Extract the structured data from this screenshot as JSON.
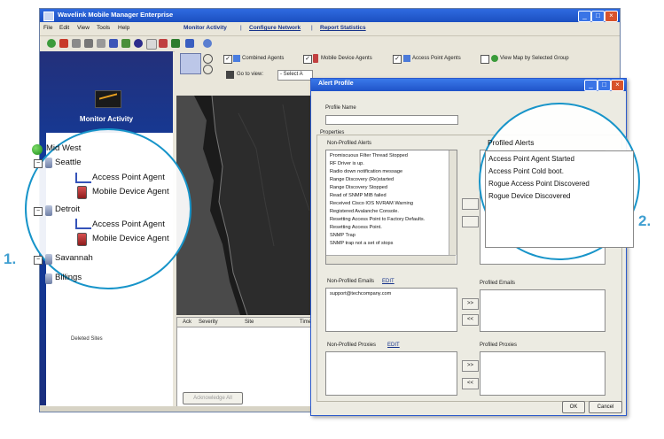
{
  "app": {
    "title": "Wavelink Mobile Manager Enterprise",
    "menu": [
      "File",
      "Edit",
      "View",
      "Tools",
      "Help"
    ],
    "nav": [
      "Monitor Activity",
      "Configure Network",
      "Report Statistics"
    ],
    "separator": "|"
  },
  "left_pane": {
    "title": "Monitor Activity",
    "deleted_sites": "Deleted Sites"
  },
  "map_toolbar": {
    "combined_agents": "Combined Agents",
    "mobile_device_agents": "Mobile Device Agents",
    "access_point_agents": "Access Point Agents",
    "view_map": "View Map by Selected Group",
    "go_to_view": "Go to view:",
    "select_value": "- Select A"
  },
  "grid": {
    "columns": [
      "Ack",
      "Severity",
      "Site",
      "Time"
    ],
    "acknowledge_button": "Acknowledge All"
  },
  "tree": {
    "root": "Mid West",
    "items": [
      {
        "label": "Seattle",
        "level": 1
      },
      {
        "label": "Access Point Agent",
        "level": 2
      },
      {
        "label": "Mobile Device Agent",
        "level": 2
      },
      {
        "label": "Detroit",
        "level": 1
      },
      {
        "label": "Access Point Agent",
        "level": 2
      },
      {
        "label": "Mobile Device Agent",
        "level": 2
      },
      {
        "label": "Savannah",
        "level": 1
      },
      {
        "label": "Billings",
        "level": 1
      }
    ]
  },
  "dialog": {
    "title": "Alert Profile",
    "profile_name_label": "Profile Name",
    "properties_label": "Properties",
    "non_profiled_alerts_label": "Non-Profiled Alerts",
    "non_profiled_alerts": [
      "Promiscuous Filter Thread Stopped",
      "RF Driver is up.",
      "Radio down notification message",
      "Range Discovery (Re)started",
      "Range Discovery Stopped",
      "Read of SNMP MIB failed",
      "Received Cisco IOS NVRAM Warning",
      "Registered Avalanche Console.",
      "Resetting Access Point to Factory Defaults.",
      "Resetting Access Point.",
      "SNMP Trap",
      "SNMP trap not a set of stops"
    ],
    "profiled_alerts_label": "Profiled Alerts",
    "profiled_alerts": [
      "Access Point Agent Started",
      "Access Point Cold boot.",
      "Rogue Access Point Discovered",
      "Rogue Device Discovered"
    ],
    "non_profiled_emails_label": "Non-Profiled Emails",
    "edit_label": "EDIT",
    "email_value": "support@techcompany.com",
    "profiled_emails_label": "Profiled Emails",
    "non_profiled_proxies_label": "Non-Profiled Proxies",
    "profiled_proxies_label": "Profiled Proxies",
    "add_label": ">>",
    "remove_label": "<<",
    "ok_label": "OK",
    "cancel_label": "Cancel"
  },
  "callouts": {
    "one": "1.",
    "two": "2."
  },
  "colors": {
    "accent": "#1794c9",
    "titlebar": "#2a62d8",
    "left_pane": "#1a3a94",
    "callout_number": "#3f9fd1"
  }
}
